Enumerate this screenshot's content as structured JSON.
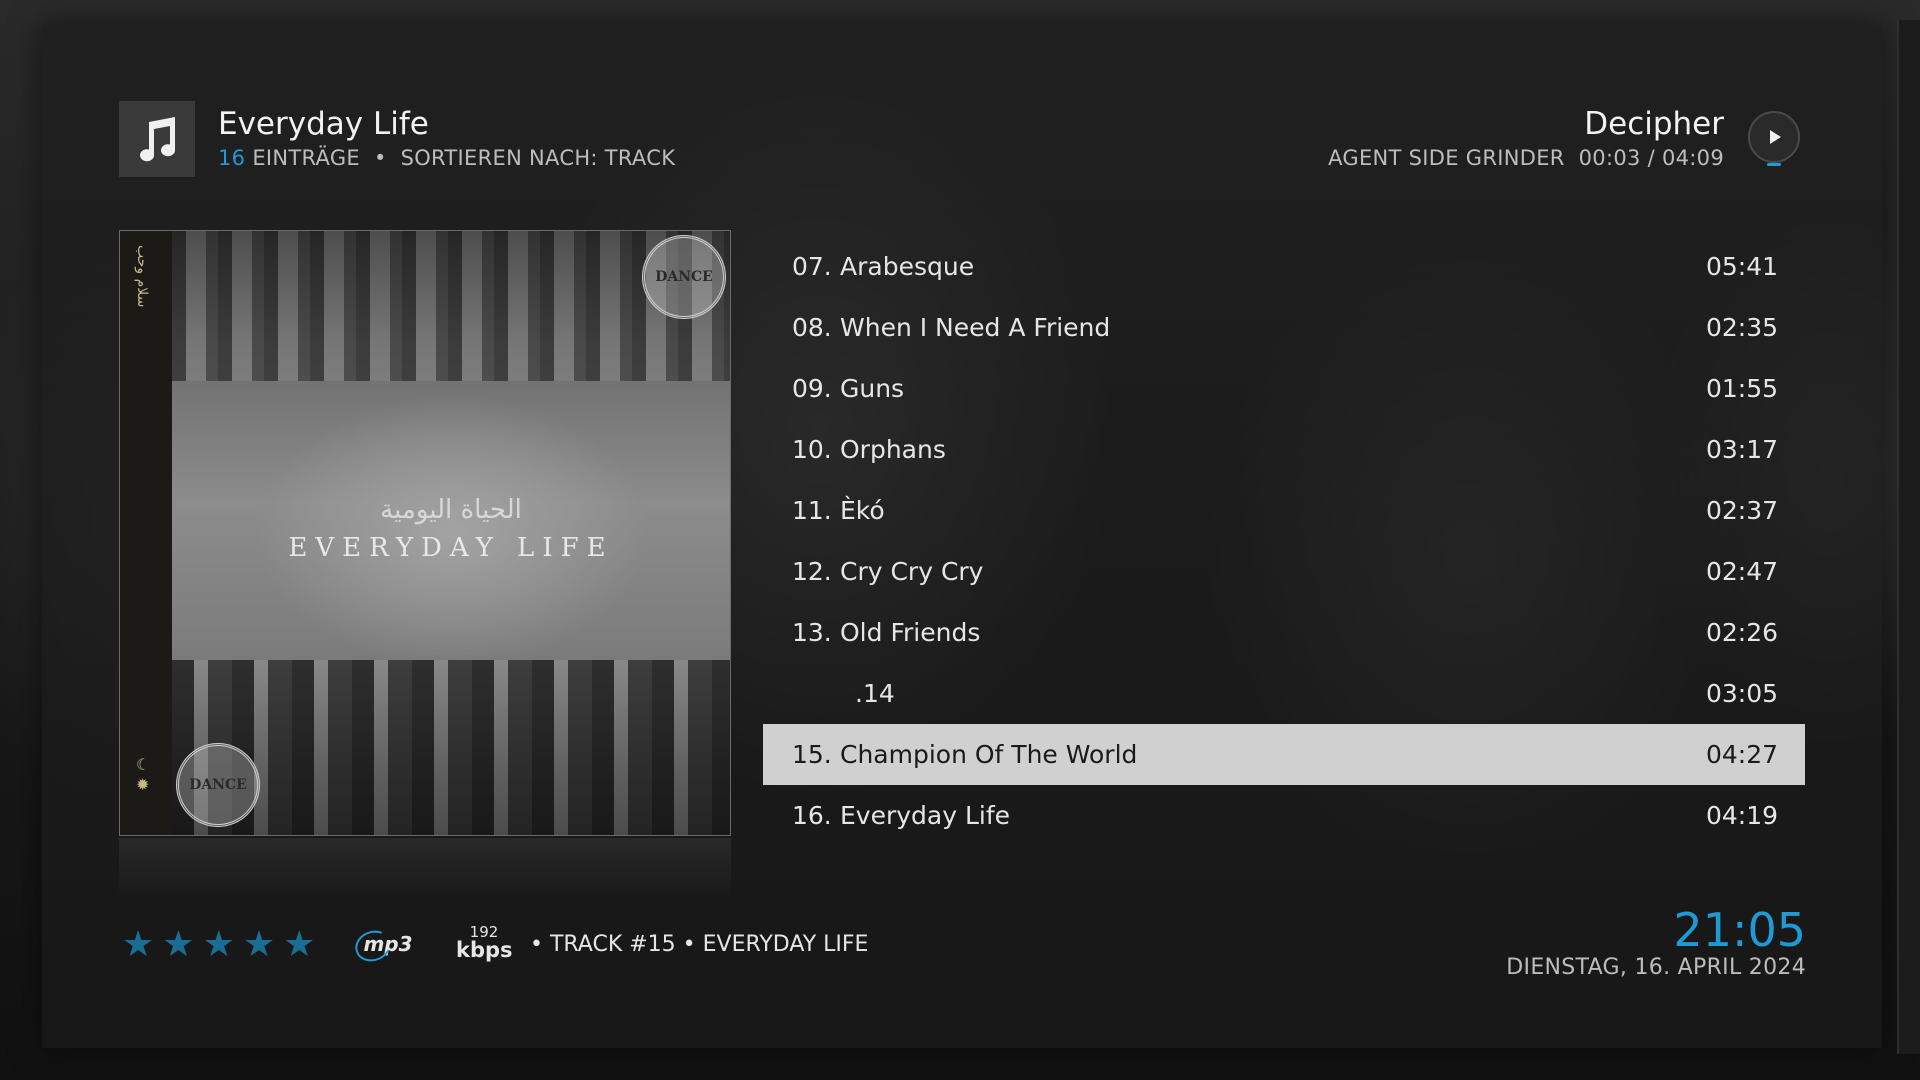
{
  "header": {
    "title": "Everyday Life",
    "count": "16",
    "count_label": "EINTRÄGE",
    "separator": "•",
    "sort_label": "SORTIEREN NACH: TRACK",
    "icon": "music-note-icon"
  },
  "now_playing": {
    "title": "Decipher",
    "artist": "AGENT SIDE GRINDER",
    "time": "00:03 / 04:09",
    "icon": "play-icon",
    "accent_color": "#1e9ad6"
  },
  "album_art": {
    "arabic_title": "الحياة اليومية",
    "title": "EVERYDAY LIFE",
    "side_text": "سلام وحب",
    "stamp_text": "DANCE"
  },
  "tracks": [
    {
      "num": "07.",
      "name": "Arabesque",
      "duration": "05:41"
    },
    {
      "num": "08.",
      "name": "When I Need A Friend",
      "duration": "02:35"
    },
    {
      "num": "09.",
      "name": "Guns",
      "duration": "01:55"
    },
    {
      "num": "10.",
      "name": "Orphans",
      "duration": "03:17"
    },
    {
      "num": "11.",
      "name": "Èkó",
      "duration": "02:37"
    },
    {
      "num": "12.",
      "name": "Cry Cry Cry",
      "duration": "02:47"
    },
    {
      "num": "13.",
      "name": "Old Friends",
      "duration": "02:26"
    },
    {
      "num": "",
      "name": ".14",
      "duration": "03:05"
    },
    {
      "num": "15.",
      "name": "Champion Of The World",
      "duration": "04:27"
    },
    {
      "num": "16.",
      "name": "Everyday Life",
      "duration": "04:19"
    }
  ],
  "selected_track_index": 8,
  "footer": {
    "rating": 5,
    "rating_max": 5,
    "codec": "mp3",
    "bitrate_value": "192",
    "bitrate_unit": "kbps",
    "track_label": "• TRACK #15 • EVERYDAY LIFE",
    "clock": "21:05",
    "date": "DIENSTAG, 16. APRIL 2024"
  }
}
